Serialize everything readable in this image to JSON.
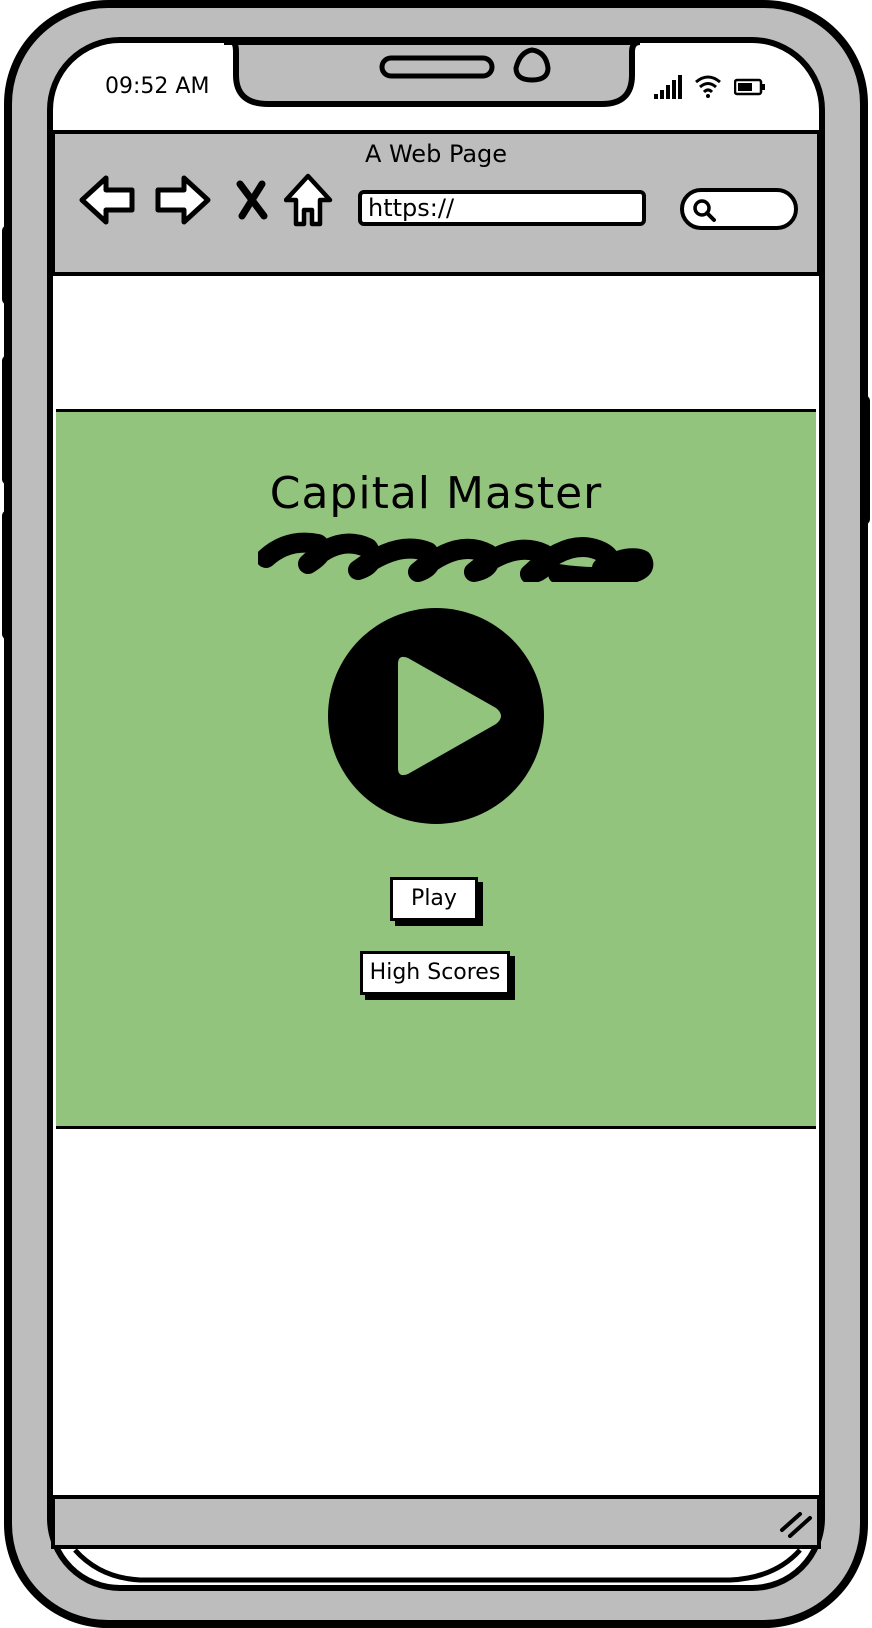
{
  "status_bar": {
    "time": "09:52 AM",
    "icons": [
      "cellular-signal-icon",
      "wifi-icon",
      "battery-icon"
    ]
  },
  "browser": {
    "title": "A Web Page",
    "url": "https://",
    "nav_icons": [
      "back-arrow-icon",
      "forward-arrow-icon",
      "close-icon",
      "home-icon",
      "search-icon"
    ]
  },
  "app": {
    "title": "Capital Master",
    "play_button": "Play",
    "high_scores_button": "High Scores"
  },
  "colors": {
    "frame": "#bdbdbd",
    "panel": "#93c47d",
    "ink": "#000000"
  }
}
